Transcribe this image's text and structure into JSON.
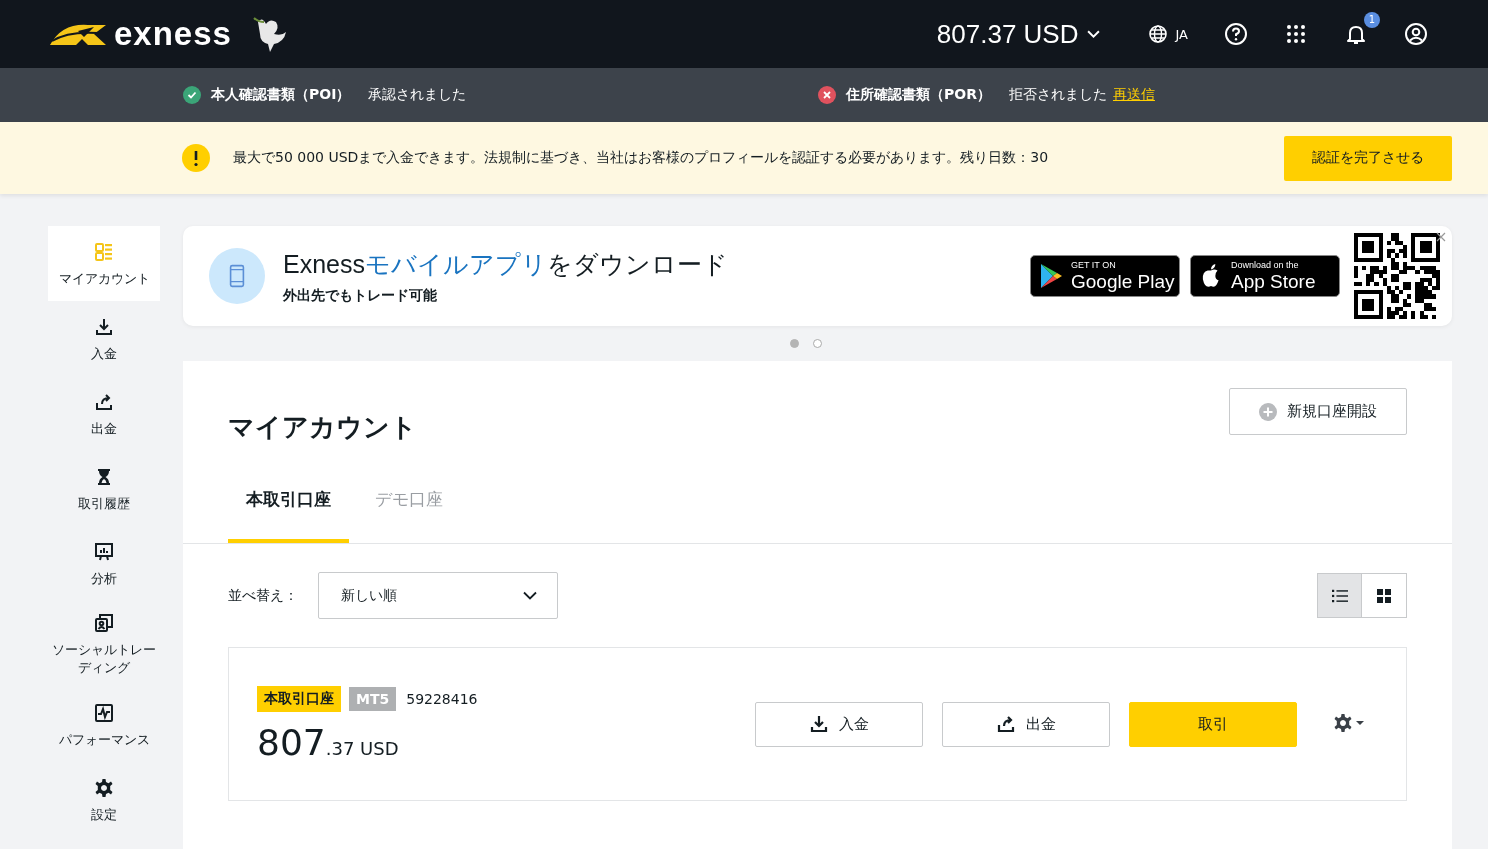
{
  "header": {
    "logo": "exness",
    "balance": "807.37 USD",
    "language": "JA",
    "notification_count": "1"
  },
  "verification": [
    {
      "label": "本人確認書類（POI）",
      "status": "承認されました",
      "kind": "approved"
    },
    {
      "label": "住所確認書類（POR）",
      "status": "拒否されました",
      "kind": "rejected",
      "action": "再送信"
    }
  ],
  "notice": {
    "text": "最大で50 000 USDまで入金できます。法規制に基づき、当社はお客様のプロフィールを認証する必要があります。残り日数：30",
    "button": "認証を完了させる"
  },
  "sidebar": {
    "items": [
      {
        "label": "マイアカウント",
        "kind": "account",
        "selected": true
      },
      {
        "label": "入金",
        "kind": "deposit",
        "selected": false
      },
      {
        "label": "出金",
        "kind": "withdraw",
        "selected": false
      },
      {
        "label": "取引履歴",
        "kind": "history",
        "selected": false
      },
      {
        "label": "分析",
        "kind": "analytics",
        "selected": false
      },
      {
        "label": "ソーシャルトレーディング",
        "kind": "social",
        "selected": false
      },
      {
        "label": "パフォーマンス",
        "kind": "performance",
        "selected": false
      },
      {
        "label": "設定",
        "kind": "settings",
        "selected": false
      }
    ]
  },
  "promo": {
    "title_start": "Exness",
    "title_highlight": "モバイルアプリ",
    "title_end": "をダウンロード",
    "subtitle": "外出先でもトレード可能",
    "stores": [
      {
        "kind": "google",
        "small": "GET IT ON",
        "large": "Google Play"
      },
      {
        "kind": "apple",
        "small": "Download on the",
        "large": "App Store"
      }
    ],
    "dots": [
      {
        "selected": true
      },
      {
        "selected": false
      }
    ]
  },
  "accounts": {
    "title": "マイアカウント",
    "new_button": "新規口座開設",
    "tabs": [
      {
        "label": "本取引口座",
        "selected": true
      },
      {
        "label": "デモ口座",
        "selected": false
      }
    ],
    "sort_label": "並べ替え：",
    "sort_value": "新しい順",
    "views": [
      {
        "kind": "list",
        "selected": true
      },
      {
        "kind": "grid",
        "selected": false
      }
    ],
    "account": {
      "type": "本取引口座",
      "platform": "MT5",
      "number": "59228416",
      "balance_whole": "807",
      "balance_rest": ".37 USD",
      "actions": [
        {
          "label": "入金",
          "kind": "deposit"
        },
        {
          "label": "出金",
          "kind": "withdraw"
        },
        {
          "label": "取引",
          "kind": "trade"
        }
      ]
    }
  }
}
